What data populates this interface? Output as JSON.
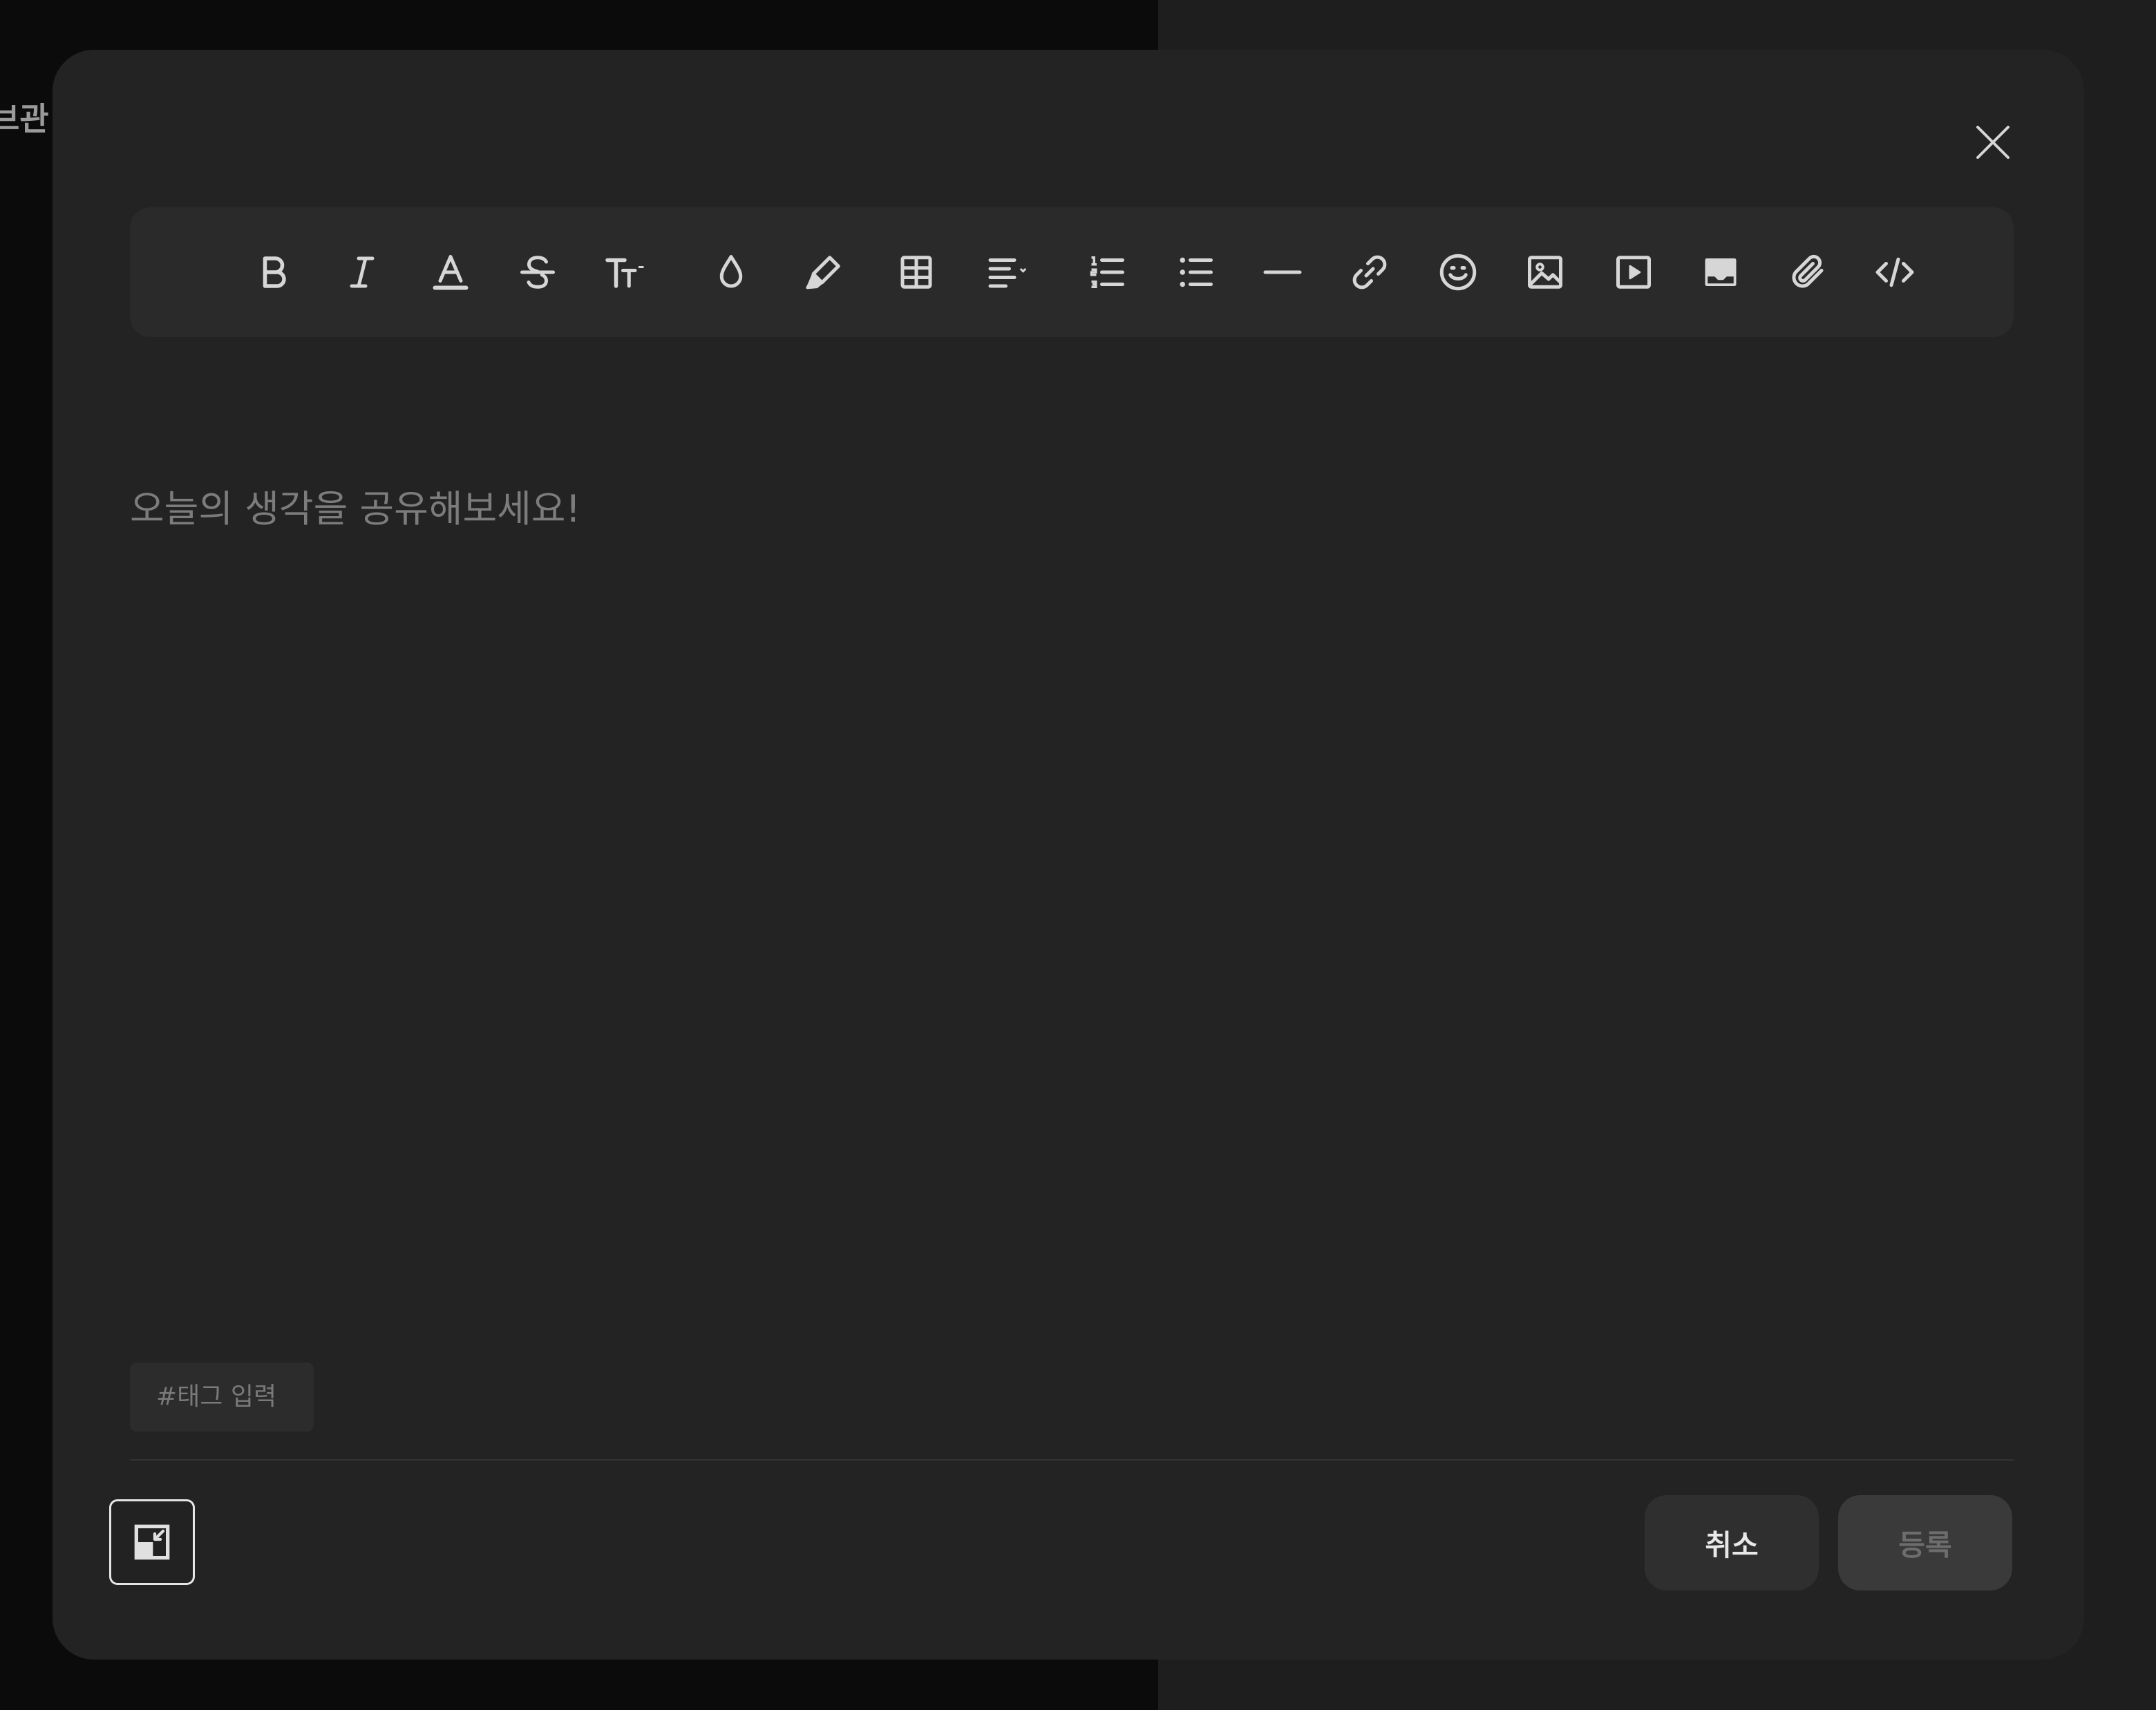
{
  "background": {
    "left_partial_text": "브관"
  },
  "modal": {
    "close_label": "×",
    "toolbar": {
      "items": [
        {
          "name": "bold-icon",
          "icon": "bold"
        },
        {
          "name": "italic-icon",
          "icon": "italic"
        },
        {
          "name": "text-color-icon",
          "icon": "text-color"
        },
        {
          "name": "strikethrough-icon",
          "icon": "strikethrough"
        },
        {
          "name": "font-size-icon",
          "icon": "font-size"
        },
        {
          "name": "color-drop-icon",
          "icon": "drop"
        },
        {
          "name": "highlighter-icon",
          "icon": "highlighter"
        },
        {
          "name": "table-icon",
          "icon": "table"
        },
        {
          "name": "align-icon",
          "icon": "align"
        },
        {
          "name": "ordered-list-icon",
          "icon": "ordered-list"
        },
        {
          "name": "bullet-list-icon",
          "icon": "bullet-list"
        },
        {
          "name": "horizontal-rule-icon",
          "icon": "horizontal-rule"
        },
        {
          "name": "link-icon",
          "icon": "link"
        },
        {
          "name": "emoji-icon",
          "icon": "emoji"
        },
        {
          "name": "image-icon",
          "icon": "image"
        },
        {
          "name": "video-icon",
          "icon": "video"
        },
        {
          "name": "embed-icon",
          "icon": "embed"
        },
        {
          "name": "attachment-icon",
          "icon": "attachment"
        },
        {
          "name": "code-icon",
          "icon": "code"
        }
      ]
    },
    "editor": {
      "placeholder": "오늘의 생각을 공유해보세요!"
    },
    "tag_input": {
      "placeholder": "#태그 입력"
    },
    "footer": {
      "cancel_label": "취소",
      "submit_label": "등록"
    }
  },
  "colors": {
    "modal_bg": "#232323",
    "toolbar_bg": "#2a2a2a",
    "icon": "#d6d6d6",
    "placeholder": "#7c7c7c"
  }
}
